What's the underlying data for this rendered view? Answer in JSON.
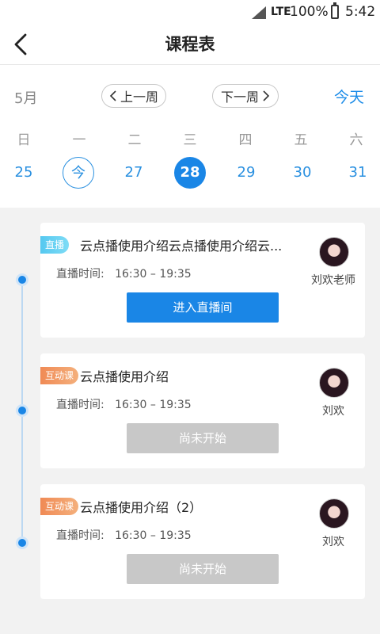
{
  "status_bar": {
    "network": "LTE",
    "battery": "100%",
    "time": "5:42"
  },
  "header": {
    "title": "课程表"
  },
  "calendar": {
    "month": "5月",
    "prev_week": "上一周",
    "next_week": "下一周",
    "today": "今天",
    "weekdays": [
      "日",
      "一",
      "二",
      "三",
      "四",
      "五",
      "六"
    ],
    "dates": [
      "25",
      "今",
      "27",
      "28",
      "29",
      "30",
      "31"
    ]
  },
  "courses": [
    {
      "tag": "直播",
      "title": "云点播使用介绍云点播使用介绍云...",
      "time_label": "直播时间:",
      "time": "16:30 – 19:35",
      "teacher": "刘欢老师",
      "button": "进入直播间"
    },
    {
      "tag": "互动课",
      "title": "云点播使用介绍",
      "time_label": "直播时间:",
      "time": "16:30 – 19:35",
      "teacher": "刘欢",
      "button": "尚未开始"
    },
    {
      "tag": "互动课",
      "title": "云点播使用介绍（2）",
      "time_label": "直播时间:",
      "time": "16:30 – 19:35",
      "teacher": "刘欢",
      "button": "尚未开始"
    }
  ]
}
